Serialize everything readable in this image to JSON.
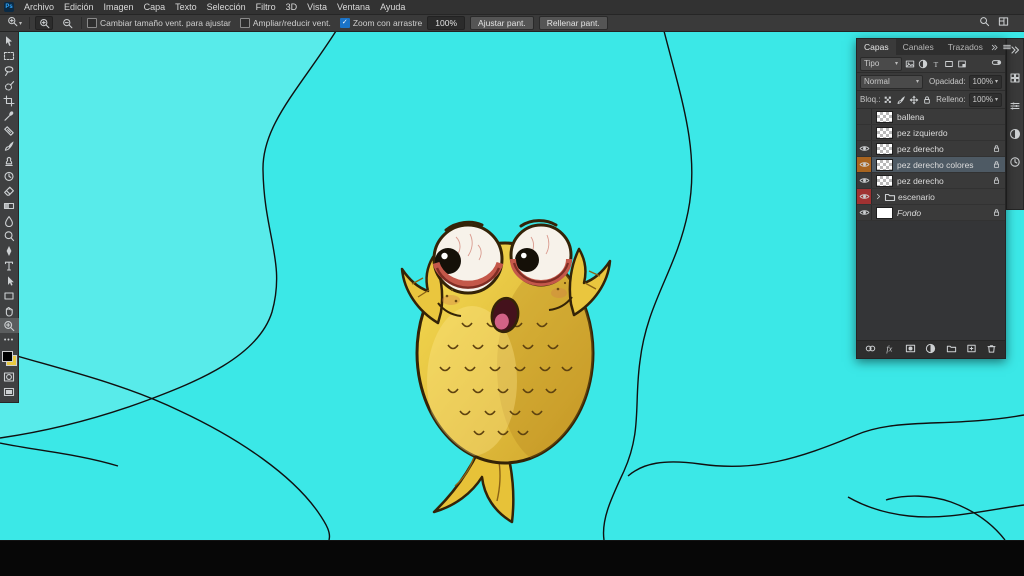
{
  "window": {
    "app_name": "Ps"
  },
  "menu_bar": {
    "items": [
      "Archivo",
      "Edición",
      "Imagen",
      "Capa",
      "Texto",
      "Selección",
      "Filtro",
      "3D",
      "Vista",
      "Ventana",
      "Ayuda"
    ]
  },
  "options_bar": {
    "active_tool": "zoom",
    "checkboxes": [
      {
        "label": "Cambiar tamaño vent. para ajustar",
        "checked": false
      },
      {
        "label": "Ampliar/reducir vent.",
        "checked": false
      },
      {
        "label": "Zoom con arrastre",
        "checked": true
      }
    ],
    "zoom_value": "100%",
    "fit_screen": "Ajustar pant.",
    "fill_screen": "Rellenar pant."
  },
  "toolbar": {
    "tools": [
      {
        "name": "move-tool",
        "icon": "move"
      },
      {
        "name": "marquee-tool",
        "icon": "marquee"
      },
      {
        "name": "lasso-tool",
        "icon": "lasso"
      },
      {
        "name": "quick-selection-tool",
        "icon": "quickselect"
      },
      {
        "name": "crop-tool",
        "icon": "crop"
      },
      {
        "name": "eyedropper-tool",
        "icon": "eyedropper"
      },
      {
        "name": "healing-brush-tool",
        "icon": "healing"
      },
      {
        "name": "brush-tool",
        "icon": "brush"
      },
      {
        "name": "clone-stamp-tool",
        "icon": "clonestamp"
      },
      {
        "name": "history-brush-tool",
        "icon": "historybrush"
      },
      {
        "name": "eraser-tool",
        "icon": "eraser"
      },
      {
        "name": "gradient-tool",
        "icon": "gradient"
      },
      {
        "name": "blur-tool",
        "icon": "blur"
      },
      {
        "name": "dodge-tool",
        "icon": "dodge"
      },
      {
        "name": "pen-tool",
        "icon": "pen"
      },
      {
        "name": "type-tool",
        "icon": "type"
      },
      {
        "name": "path-selection-tool",
        "icon": "pathselect"
      },
      {
        "name": "shape-tool",
        "icon": "shape"
      },
      {
        "name": "hand-tool",
        "icon": "hand"
      },
      {
        "name": "zoom-tool",
        "icon": "zoom",
        "active": true
      }
    ],
    "foreground_color": "#000000",
    "background_color": "#e8c83f"
  },
  "canvas": {
    "background_color": "#3BE8E7"
  },
  "layers_panel": {
    "tabs": [
      {
        "label": "Capas",
        "active": true
      },
      {
        "label": "Canales",
        "active": false
      },
      {
        "label": "Trazados",
        "active": false
      }
    ],
    "filter_label": "Tipo",
    "blend_mode": "Normal",
    "opacity_label": "Opacidad:",
    "opacity_value": "100%",
    "lock_label": "Bloq.:",
    "fill_label": "Relleno:",
    "fill_value": "100%",
    "layers": [
      {
        "name": "ballena",
        "visible": false,
        "thumb": "checker",
        "locked": false,
        "selected": false,
        "label_color": null,
        "group": false,
        "italic": false
      },
      {
        "name": "pez izquierdo",
        "visible": false,
        "thumb": "checker",
        "locked": false,
        "selected": false,
        "label_color": null,
        "group": false,
        "italic": false
      },
      {
        "name": "pez derecho",
        "visible": true,
        "thumb": "checker",
        "locked": true,
        "selected": false,
        "label_color": null,
        "group": false,
        "italic": false
      },
      {
        "name": "pez derecho colores",
        "visible": true,
        "thumb": "checker",
        "locked": true,
        "selected": true,
        "label_color": "#a8641f",
        "group": false,
        "italic": false
      },
      {
        "name": "pez derecho",
        "visible": true,
        "thumb": "checker",
        "locked": true,
        "selected": false,
        "label_color": null,
        "group": false,
        "italic": false
      },
      {
        "name": "escenario",
        "visible": true,
        "thumb": "group",
        "locked": false,
        "selected": false,
        "label_color": "#a03232",
        "group": true,
        "italic": false
      },
      {
        "name": "Fondo",
        "visible": true,
        "thumb": "white",
        "locked": true,
        "selected": false,
        "label_color": null,
        "group": false,
        "italic": true
      }
    ],
    "bottom_icons": [
      {
        "name": "link-layers-icon",
        "icon": "link"
      },
      {
        "name": "layer-effects-icon",
        "icon": "fx"
      },
      {
        "name": "layer-mask-icon",
        "icon": "mask"
      },
      {
        "name": "adjustment-layer-icon",
        "icon": "adjust"
      },
      {
        "name": "new-group-icon",
        "icon": "folder"
      },
      {
        "name": "new-layer-icon",
        "icon": "newlayer"
      },
      {
        "name": "delete-layer-icon",
        "icon": "trash"
      }
    ]
  },
  "right_dock": {
    "icons": [
      {
        "name": "expand-dock-icon",
        "icon": "chevrons"
      },
      {
        "name": "color-panel-icon",
        "icon": "grid4"
      },
      {
        "name": "properties-panel-icon",
        "icon": "sliders"
      },
      {
        "name": "adjustments-panel-icon",
        "icon": "adjust"
      },
      {
        "name": "history-panel-icon",
        "icon": "clock"
      }
    ]
  }
}
